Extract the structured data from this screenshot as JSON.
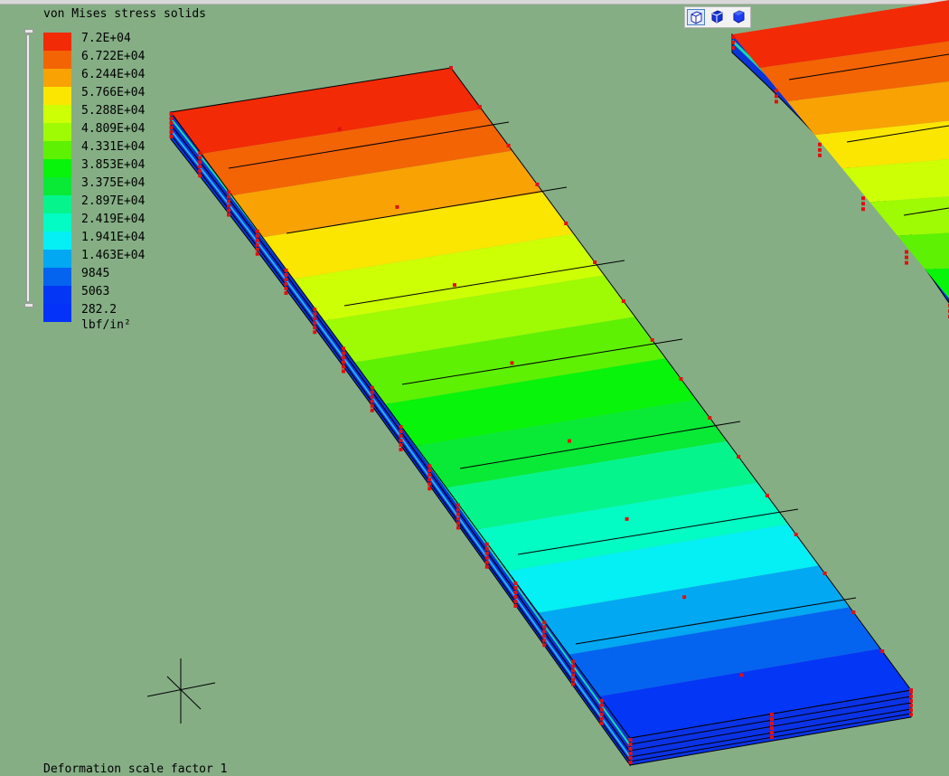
{
  "legend": {
    "title": "von Mises stress solids",
    "units": "lbf/in²",
    "entries": [
      {
        "label": "7.2E+04",
        "color": "#F32A06"
      },
      {
        "label": "6.722E+04",
        "color": "#F36404"
      },
      {
        "label": "6.244E+04",
        "color": "#F8A204"
      },
      {
        "label": "5.766E+04",
        "color": "#FAE600"
      },
      {
        "label": "5.288E+04",
        "color": "#CDFF05"
      },
      {
        "label": "4.809E+04",
        "color": "#9EFB04"
      },
      {
        "label": "4.331E+04",
        "color": "#5EF104"
      },
      {
        "label": "3.853E+04",
        "color": "#08F40A"
      },
      {
        "label": "3.375E+04",
        "color": "#08EA35"
      },
      {
        "label": "2.897E+04",
        "color": "#05F58C"
      },
      {
        "label": "2.419E+04",
        "color": "#03FBC4"
      },
      {
        "label": "1.941E+04",
        "color": "#04F0F4"
      },
      {
        "label": "1.463E+04",
        "color": "#03A8F3"
      },
      {
        "label": "9845",
        "color": "#0464F0"
      },
      {
        "label": "5063",
        "color": "#0436F6"
      },
      {
        "label": "282.2",
        "color": "#0432F8"
      }
    ]
  },
  "viewport": {
    "background": "#85AE85",
    "footer_text": "Deformation scale factor 1"
  },
  "view_toolbar": {
    "buttons": [
      {
        "icon": "isometric-view-icon",
        "active": true
      },
      {
        "icon": "shaded-view-icon",
        "active": false
      },
      {
        "icon": "solid-view-icon",
        "active": false
      }
    ]
  }
}
